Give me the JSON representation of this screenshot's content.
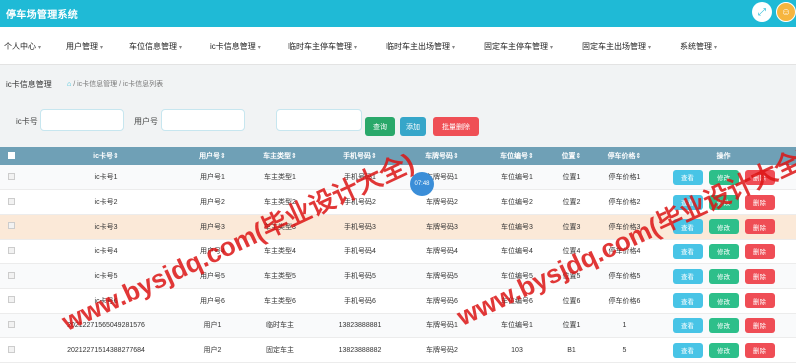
{
  "header": {
    "title": "停车场管理系统",
    "expand_icon": "expand-icon",
    "avatar_icon": "user-avatar-icon"
  },
  "nav": [
    "个人中心",
    "用户管理",
    "车位信息管理",
    "ic卡信息管理",
    "临时车主停车管理",
    "临时车主出场管理",
    "固定车主停车管理",
    "固定车主出场管理",
    "系统管理"
  ],
  "breadcrumb": {
    "title": "ic卡信息管理",
    "path": "/ ic卡信息管理 / ic卡信息列表"
  },
  "search": {
    "card_label": "ic卡号",
    "card_placeholder": "",
    "user_label": "用户号",
    "user_placeholder": "",
    "third_placeholder": "",
    "search_btn": "查询",
    "add_btn": "添加",
    "batch_delete_btn": "批量删除"
  },
  "table": {
    "headers": [
      "ic卡号⇕",
      "用户号⇕",
      "车主类型⇕",
      "手机号码⇕",
      "车牌号码⇕",
      "车位编号⇕",
      "位置⇕",
      "停车价格⇕",
      "操作"
    ],
    "rows": [
      [
        "ic卡号1",
        "用户号1",
        "车主类型1",
        "手机号码1",
        "车牌号码1",
        "车位编号1",
        "位置1",
        "停车价格1"
      ],
      [
        "ic卡号2",
        "用户号2",
        "车主类型2",
        "手机号码2",
        "车牌号码2",
        "车位编号2",
        "位置2",
        "停车价格2"
      ],
      [
        "ic卡号3",
        "用户号3",
        "车主类型3",
        "手机号码3",
        "车牌号码3",
        "车位编号3",
        "位置3",
        "停车价格3"
      ],
      [
        "ic卡号4",
        "用户号4",
        "车主类型4",
        "手机号码4",
        "车牌号码4",
        "车位编号4",
        "位置4",
        "停车价格4"
      ],
      [
        "ic卡号5",
        "用户号5",
        "车主类型5",
        "手机号码5",
        "车牌号码5",
        "车位编号5",
        "位置5",
        "停车价格5"
      ],
      [
        "ic卡号6",
        "用户号6",
        "车主类型6",
        "手机号码6",
        "车牌号码6",
        "车位编号6",
        "位置6",
        "停车价格6"
      ],
      [
        "20212271565049281576",
        "用户1",
        "临时车主",
        "13823888881",
        "车牌号码1",
        "车位编号1",
        "位置1",
        "1"
      ],
      [
        "20212271514388277684",
        "用户2",
        "固定车主",
        "13823888882",
        "车牌号码2",
        "103",
        "B1",
        "5"
      ]
    ],
    "op_view": "查看",
    "op_edit": "修改",
    "op_delete": "删除"
  },
  "watermark": "www.bysjdq.com(毕业设计大全)",
  "timer_badge": "07:48",
  "colors": {
    "topbar": "#1fbad6",
    "table_header": "#6fa0b6",
    "view": "#48c4e6",
    "edit": "#2dbf8a",
    "delete": "#ef4d55"
  }
}
